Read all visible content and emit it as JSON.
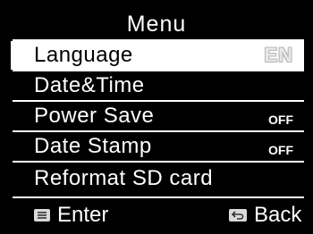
{
  "screen": {
    "title": "Menu"
  },
  "menu": {
    "items": [
      {
        "label": "Language",
        "value": "EN",
        "selected": true
      },
      {
        "label": "Date&Time",
        "value": ""
      },
      {
        "label": "Power Save",
        "value": "OFF"
      },
      {
        "label": "Date Stamp",
        "value": "OFF"
      },
      {
        "label": "Reformat SD card",
        "value": ""
      }
    ]
  },
  "footer": {
    "enter_label": "Enter",
    "enter_icon": "menu-key-icon",
    "back_label": "Back",
    "back_icon": "return-arrow-icon"
  },
  "colors": {
    "background": "#000000",
    "text": "#ffffff",
    "highlight": "#ffffff",
    "highlight_text": "#000000"
  }
}
